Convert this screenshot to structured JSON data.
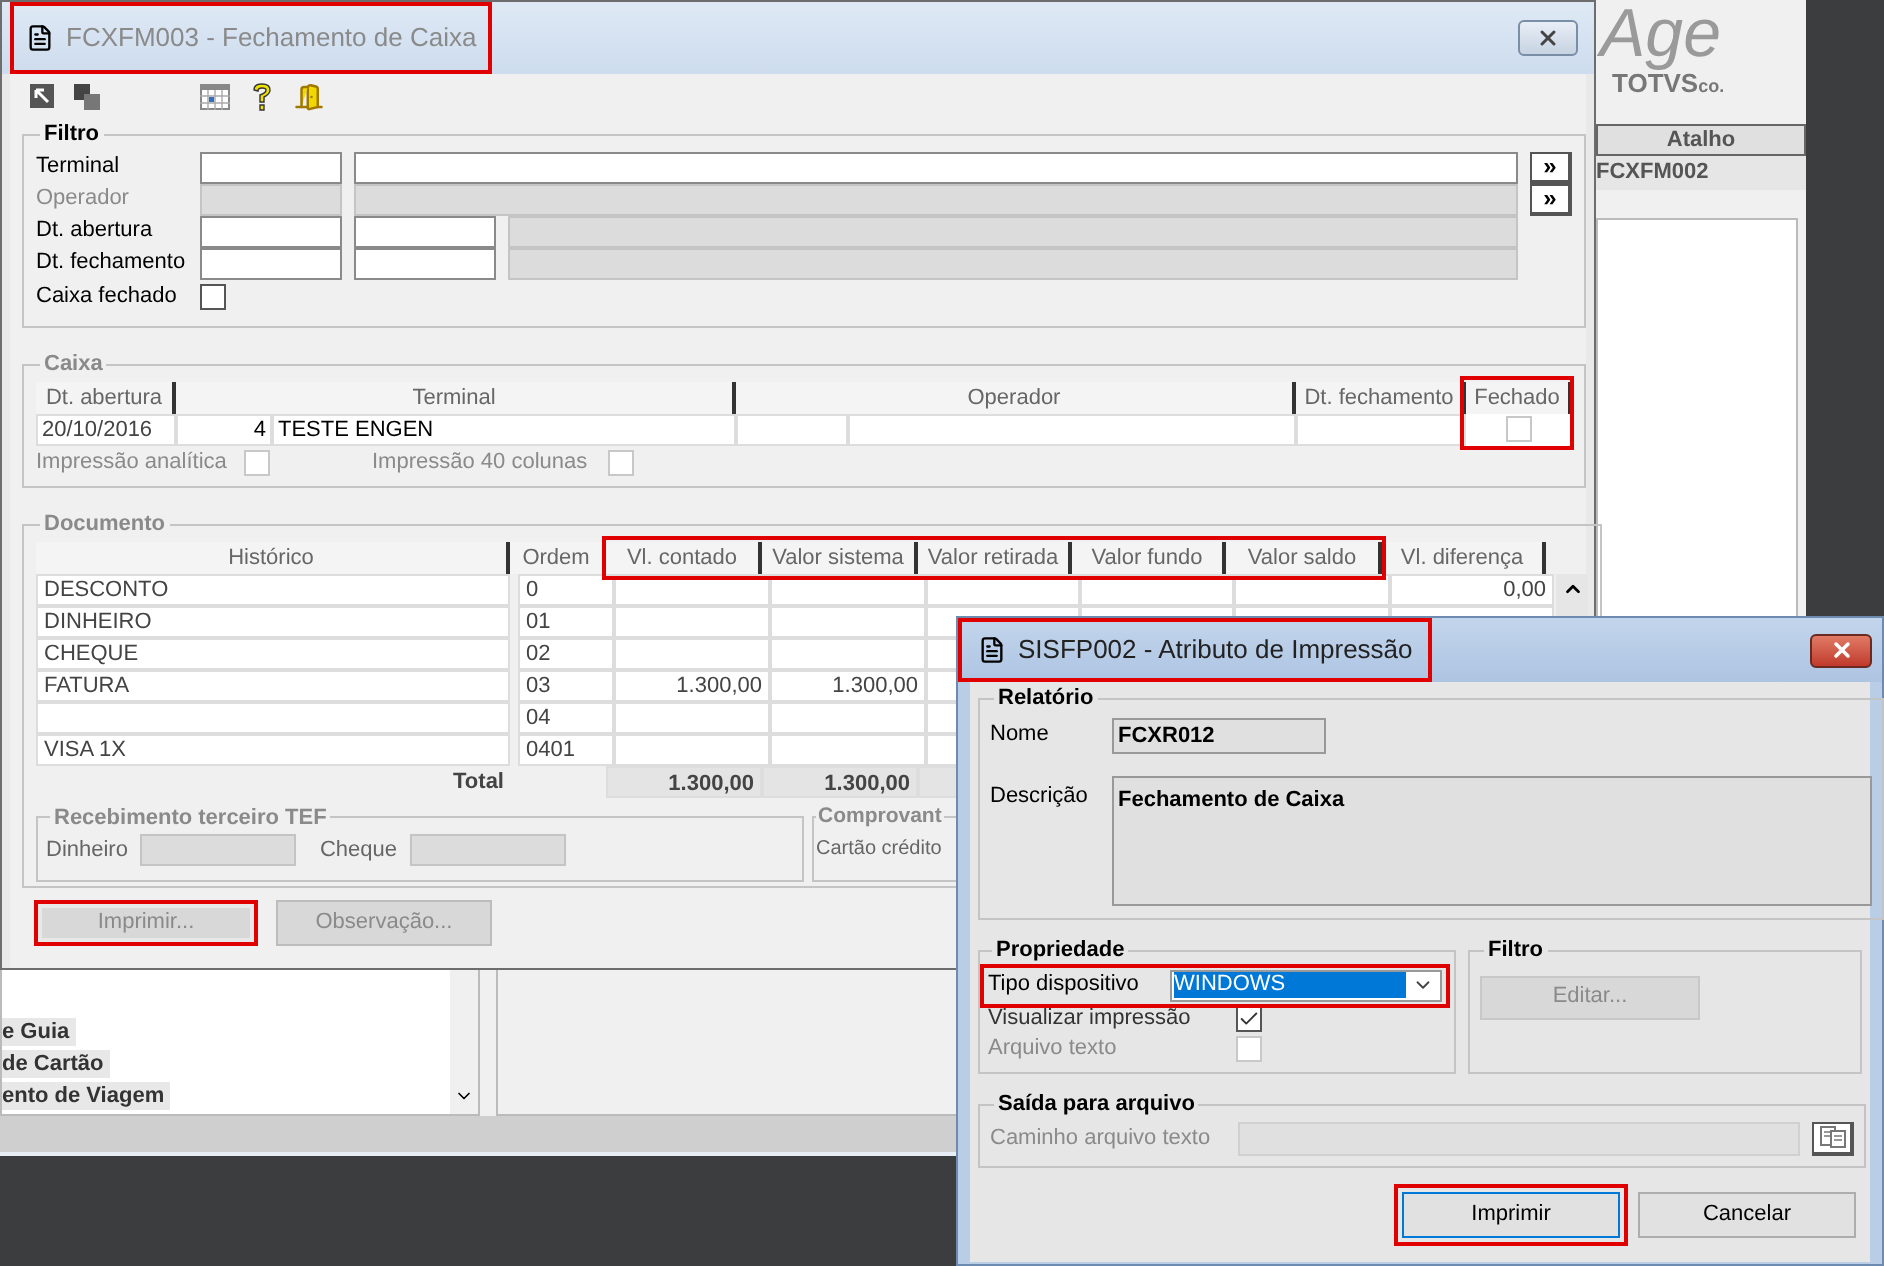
{
  "background_app": {
    "logo_text": "Age",
    "logo_brand": "TOTVS",
    "logo_suffix": "co.",
    "shortcut_header": "Atalho",
    "shortcut_row": "FCXFM002",
    "list_items": [
      "e Guia",
      "de Cartão",
      "ento de Viagem"
    ]
  },
  "main_window": {
    "title": "FCXFM003 - Fechamento de Caixa",
    "title_highlighted": true,
    "filtro": {
      "legend": "Filtro",
      "terminal_label": "Terminal",
      "operador": {
        "label": "Operador",
        "disabled": true
      },
      "dt_abertura_label": "Dt. abertura",
      "dt_fechamento_label": "Dt. fechamento",
      "caixa_fechado": {
        "label": "Caixa fechado",
        "checked": false
      },
      "lookup_buttons": [
        "»",
        "»"
      ]
    },
    "caixa": {
      "legend": "Caixa",
      "columns": [
        {
          "label": "Dt. abertura",
          "highlighted": false
        },
        {
          "label": "Terminal",
          "highlighted": false
        },
        {
          "label": "Operador",
          "highlighted": false
        },
        {
          "label": "Dt. fechamento",
          "highlighted": false
        },
        {
          "label": "Fechado",
          "highlighted": true
        }
      ],
      "row": {
        "dt_abertura": "20/10/2016",
        "terminal_code": "4",
        "terminal_name": "TESTE ENGEN",
        "fechado": false
      },
      "options": [
        {
          "label": "Impressão analítica",
          "checked": false
        },
        {
          "label": "Impressão 40 colunas",
          "checked": false
        }
      ]
    },
    "documento": {
      "legend": "Documento",
      "columns": [
        {
          "label": "Histórico",
          "highlighted": false
        },
        {
          "label": "Ordem",
          "highlighted": false
        },
        {
          "label": "Vl. contado",
          "highlighted": true
        },
        {
          "label": "Valor sistema",
          "highlighted": true
        },
        {
          "label": "Valor retirada",
          "highlighted": true
        },
        {
          "label": "Valor fundo",
          "highlighted": true
        },
        {
          "label": "Valor saldo",
          "highlighted": true
        },
        {
          "label": "Vl. diferença",
          "highlighted": false
        }
      ],
      "rows": [
        {
          "historico": "DESCONTO",
          "ordem": "0",
          "vl_diferenca": "0,00"
        },
        {
          "historico": "DINHEIRO",
          "ordem": "01"
        },
        {
          "historico": "CHEQUE",
          "ordem": "02"
        },
        {
          "historico": "FATURA",
          "ordem": "03",
          "vl_contado": "1.300,00",
          "valor_sistema": "1.300,00"
        },
        {
          "ordem": "04"
        },
        {
          "historico": "VISA 1X",
          "ordem": "0401"
        }
      ],
      "total": {
        "historico": "Total",
        "vl_contado": "1.300,00",
        "valor_sistema": "1.300,00"
      },
      "tef": {
        "legend": "Recebimento terceiro TEF",
        "fields": [
          "Dinheiro",
          "Cheque"
        ]
      },
      "comprovante": {
        "legend": "Comprovant",
        "field": "Cartão crédito"
      }
    },
    "buttons": [
      {
        "label": "Imprimir...",
        "disabled": true,
        "highlighted": true
      },
      {
        "label": "Observação...",
        "disabled": true,
        "highlighted": false
      }
    ]
  },
  "dialog": {
    "title": "SISFP002 - Atributo de Impressão",
    "title_highlighted": true,
    "relatorio": {
      "legend": "Relatório",
      "nome_label": "Nome",
      "nome": "FCXR012",
      "descricao_label": "Descrição",
      "descricao": "Fechamento de Caixa"
    },
    "propriedade": {
      "legend": "Propriedade",
      "tipo_label": "Tipo dispositivo",
      "tipo_value": "WINDOWS",
      "tipo_highlighted": true,
      "options": [
        {
          "label": "Visualizar impressão",
          "checked": true,
          "disabled": false
        },
        {
          "label": "Arquivo texto",
          "checked": false,
          "disabled": true
        }
      ]
    },
    "filtro": {
      "legend": "Filtro",
      "button": {
        "label": "Editar...",
        "disabled": true
      }
    },
    "saida": {
      "legend": "Saída para arquivo",
      "label": "Caminho arquivo texto",
      "disabled": true
    },
    "buttons": [
      {
        "label": "Imprimir",
        "highlighted": true
      },
      {
        "label": "Cancelar",
        "highlighted": false
      }
    ]
  }
}
